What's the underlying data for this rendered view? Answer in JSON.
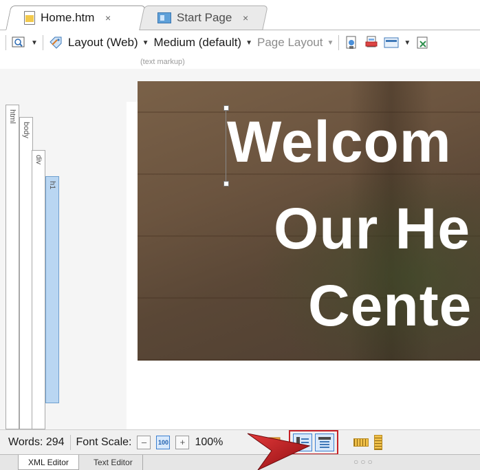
{
  "tabs": [
    {
      "label": "Home.htm",
      "close": "×"
    },
    {
      "label": "Start Page",
      "close": "×"
    }
  ],
  "toolbar": {
    "layout_label": "Layout (Web)",
    "size_label": "Medium (default)",
    "page_layout_label": "Page Layout",
    "subhint": "(text markup)"
  },
  "tag_labels": [
    "html",
    "body",
    "div",
    "h1"
  ],
  "hero": {
    "line1": "Welcom",
    "line2": "Our He",
    "line3": "Cente"
  },
  "status": {
    "words": "Words: 294",
    "font_scale": "Font Scale:",
    "zoom": "100%",
    "minus": "–",
    "hundred": "100",
    "plus": "+"
  },
  "bottom_tabs": [
    "XML Editor",
    "Text Editor"
  ],
  "dots": "○○○",
  "colors": {
    "highlight": "#c62026",
    "accent": "#3b7fd0",
    "tag_highlight": "#b9d6f2"
  }
}
